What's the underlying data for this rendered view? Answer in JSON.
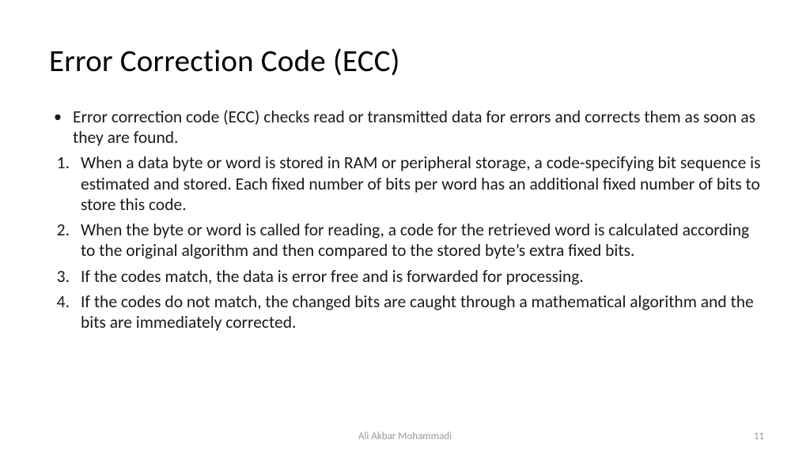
{
  "title": "Error Correction Code (ECC)",
  "intro_bullet": "Error correction code (ECC) checks read or transmitted data for errors and corrects them as soon as they are found.",
  "points": [
    "When a data byte or word is stored in RAM or peripheral storage, a code-specifying bit sequence is estimated and stored. Each fixed number of bits per word has an additional fixed number of bits to store this code.",
    "When the byte or word is called for reading, a code for the retrieved word is calculated according to the original algorithm and then compared to the stored byte’s extra fixed bits.",
    "If the codes match, the data is error free and is forwarded for processing.",
    "If the codes do not match, the changed bits are caught through a mathematical algorithm and the bits are immediately corrected."
  ],
  "numbers": [
    "1.",
    "2.",
    "3.",
    "4."
  ],
  "footer_author": "Ali Akbar Mohammadi",
  "page_number": "11"
}
